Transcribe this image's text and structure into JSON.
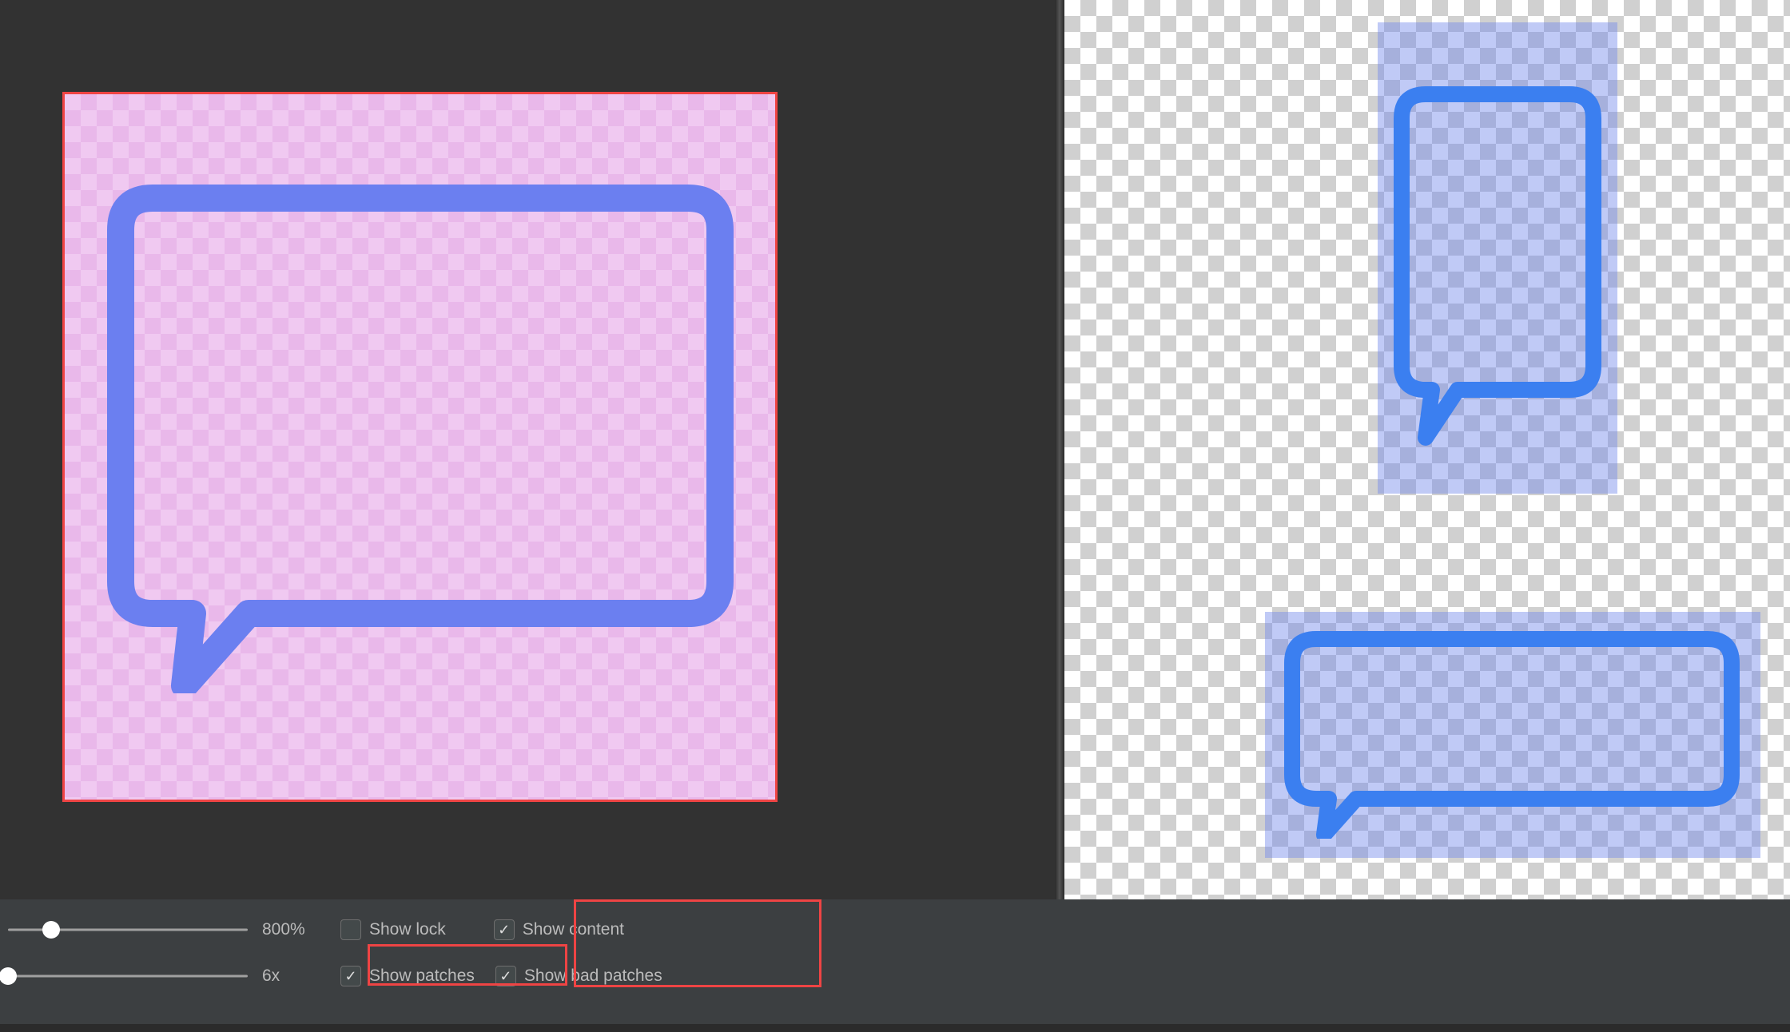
{
  "left_canvas": {
    "border_color": "#ef4444",
    "overlay_tint": "#f0c9f1"
  },
  "right_preview": {
    "shapes": [
      {
        "name": "vertical-bubble",
        "tint": "rgba(116,137,234,0.45)"
      },
      {
        "name": "horizontal-bubble",
        "tint": "rgba(116,137,234,0.45)"
      }
    ]
  },
  "controls": {
    "zoom": {
      "value_label": "800%",
      "slider_pos": 0.18
    },
    "scale": {
      "value_label": "6x",
      "slider_pos": 0.0
    },
    "checkboxes": {
      "show_lock": {
        "label": "Show lock",
        "checked": false
      },
      "show_patches": {
        "label": "Show patches",
        "checked": true
      },
      "show_content": {
        "label": "Show content",
        "checked": true
      },
      "show_bad_patches": {
        "label": "Show bad patches",
        "checked": true
      }
    }
  },
  "highlight_color": "#ef4444",
  "icons": {
    "speech_bubble_stroke": "#6b7ff0"
  }
}
